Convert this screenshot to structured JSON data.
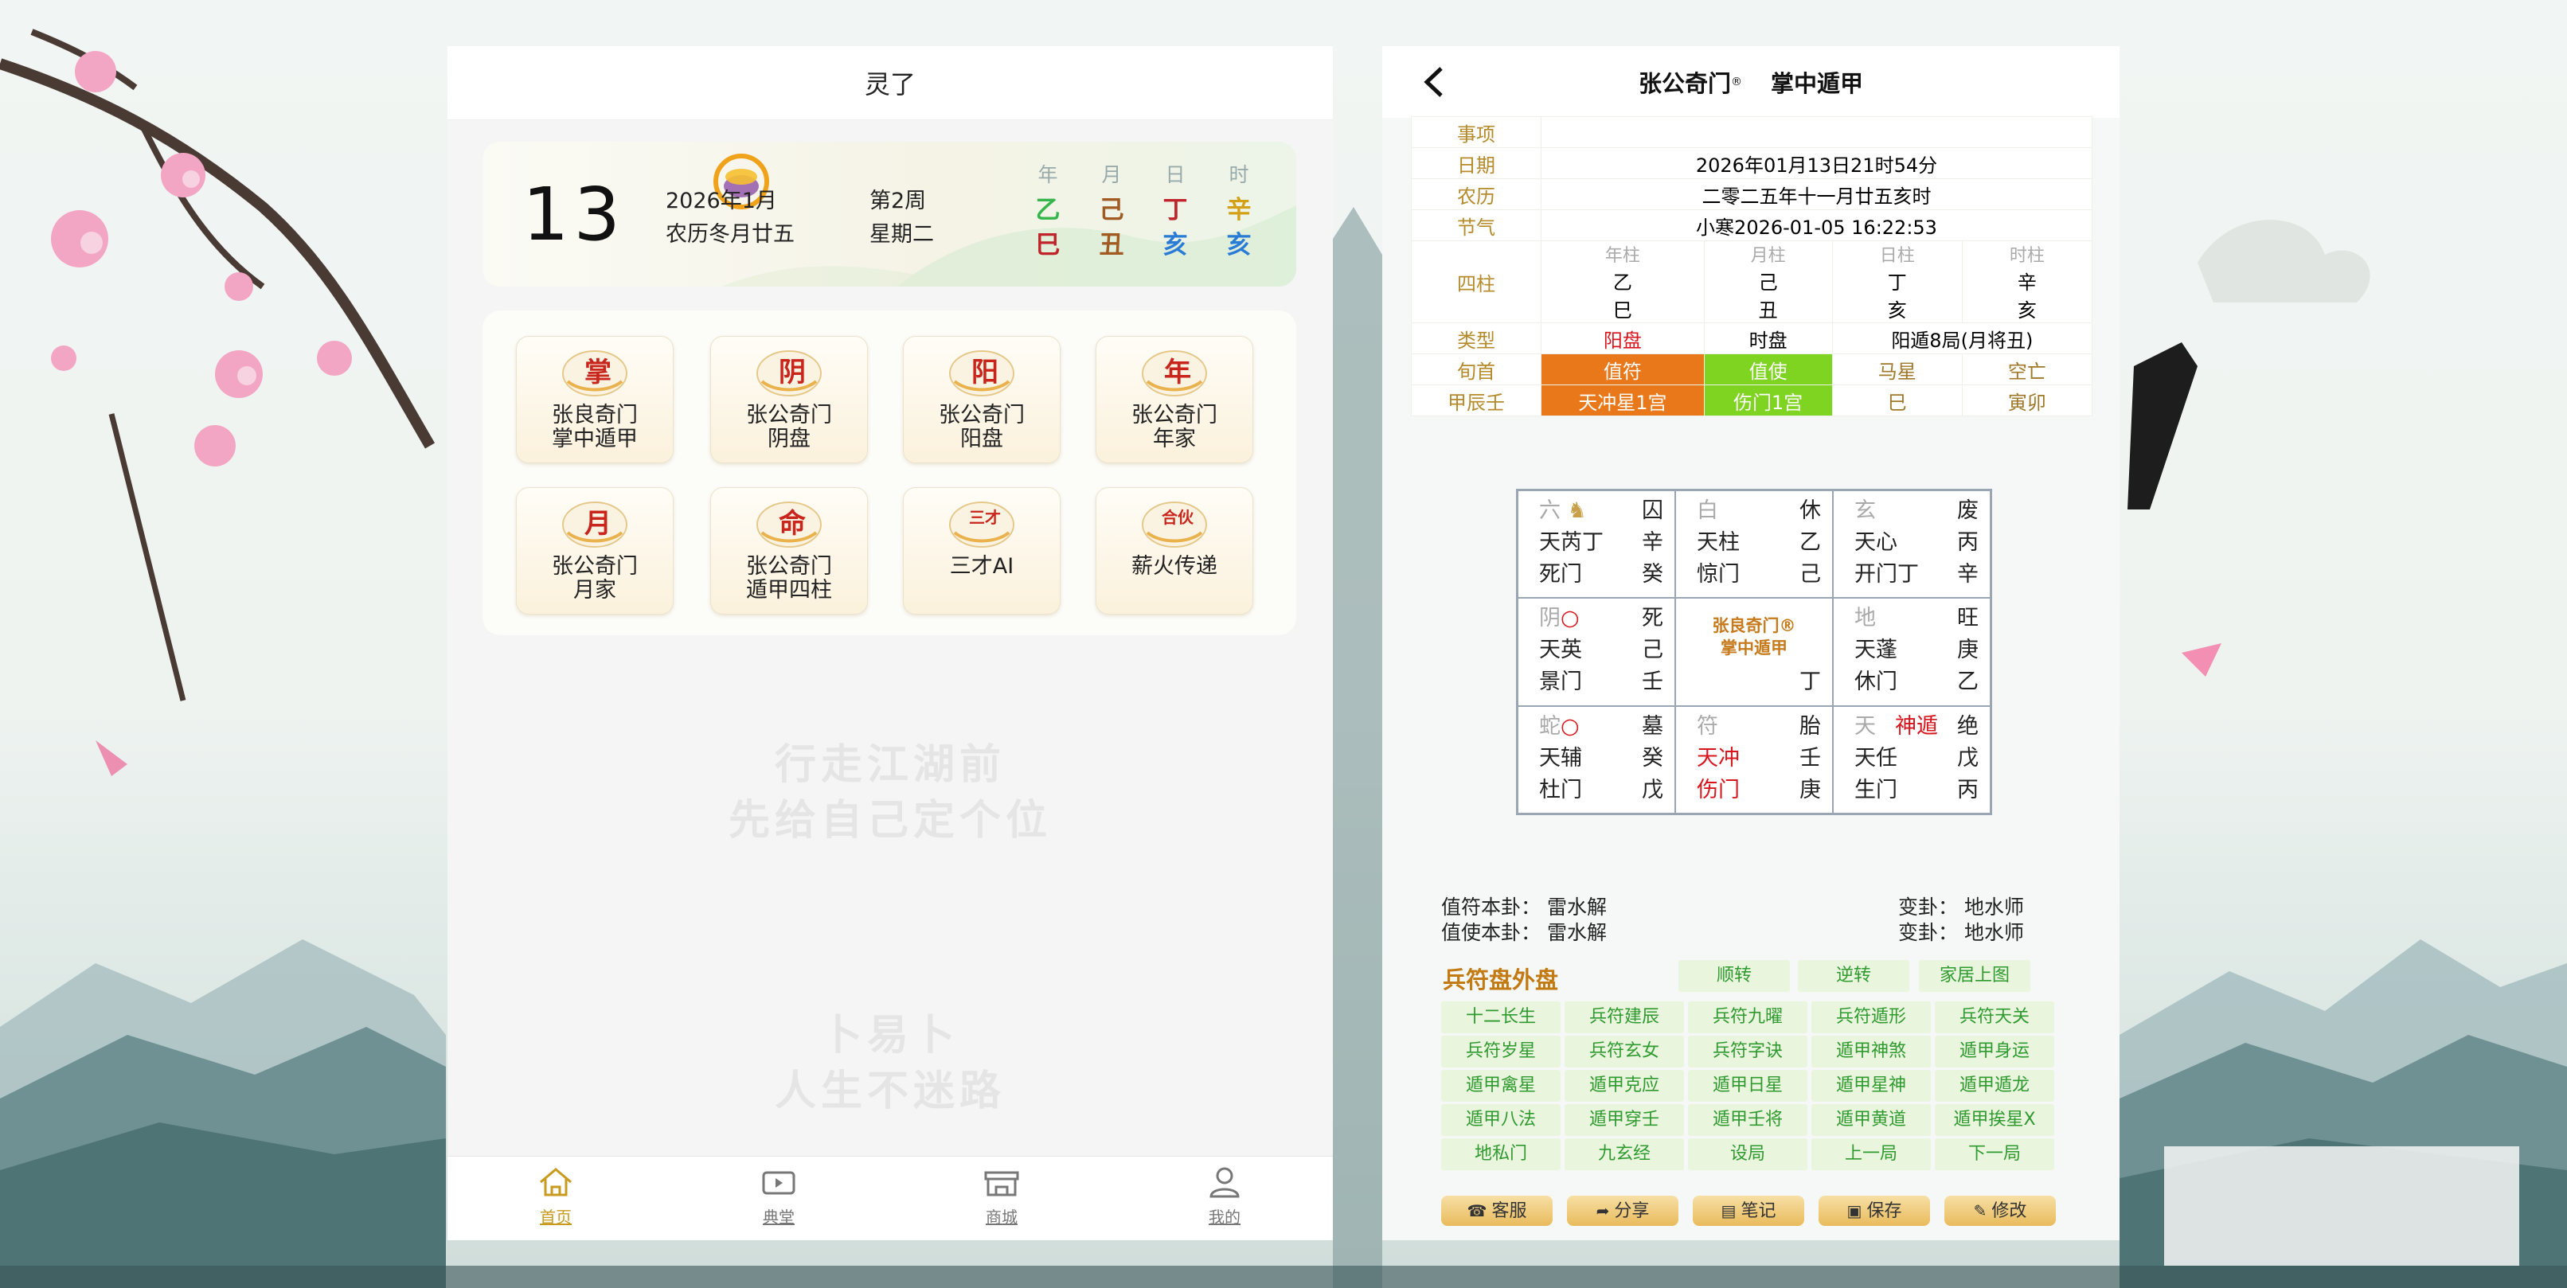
{
  "left_app": {
    "title": "灵了",
    "date": {
      "day": "13",
      "year_month": "2026年1月",
      "lunar": "农历冬月廿五",
      "week": "第2周",
      "weekday": "星期二"
    },
    "ganzhi": [
      {
        "head": "年",
        "stem": "乙",
        "branch": "巳",
        "stem_color": "#35b54a",
        "branch_color": "#c0242b"
      },
      {
        "head": "月",
        "stem": "己",
        "branch": "丑",
        "stem_color": "#a05a22",
        "branch_color": "#a05a22"
      },
      {
        "head": "日",
        "stem": "丁",
        "branch": "亥",
        "stem_color": "#c0242b",
        "branch_color": "#2a7bd4"
      },
      {
        "head": "时",
        "stem": "辛",
        "branch": "亥",
        "stem_color": "#d4a017",
        "branch_color": "#2a7bd4"
      }
    ],
    "menu": [
      {
        "emblem": "掌",
        "line1": "张良奇门",
        "line2": "掌中遁甲"
      },
      {
        "emblem": "阴",
        "line1": "张公奇门",
        "line2": "阴盘"
      },
      {
        "emblem": "阳",
        "line1": "张公奇门",
        "line2": "阳盘"
      },
      {
        "emblem": "年",
        "line1": "张公奇门",
        "line2": "年家"
      },
      {
        "emblem": "月",
        "line1": "张公奇门",
        "line2": "月家"
      },
      {
        "emblem": "命",
        "line1": "张公奇门",
        "line2": "遁甲四柱"
      },
      {
        "emblem": "三才",
        "line1": "三才AI",
        "line2": ""
      },
      {
        "emblem": "合伙",
        "line1": "薪火传递",
        "line2": ""
      }
    ],
    "watermark": [
      "行走江湖前",
      "先给自己定个位",
      "卜易卜",
      "人生不迷路"
    ],
    "nav": [
      {
        "label": "首页",
        "icon": "home-icon",
        "active": true
      },
      {
        "label": "典堂",
        "icon": "tv-icon",
        "active": false
      },
      {
        "label": "商城",
        "icon": "shop-icon",
        "active": false
      },
      {
        "label": "我的",
        "icon": "user-icon",
        "active": false
      }
    ]
  },
  "right_app": {
    "header": {
      "title": "张公奇门",
      "reg": "®",
      "subtitle": "掌中遁甲"
    },
    "info": {
      "items_label": "事项",
      "date_label": "日期",
      "date_value": "2026年01月13日21时54分",
      "lunar_label": "农历",
      "lunar_value": "二零二五年十一月廿五亥时",
      "term_label": "节气",
      "term_value": "小寒2026-01-05 16:22:53",
      "pillars_label": "四柱",
      "pillars": [
        {
          "head": "年柱",
          "stem": "乙",
          "branch": "巳"
        },
        {
          "head": "月柱",
          "stem": "己",
          "branch": "丑"
        },
        {
          "head": "日柱",
          "stem": "丁",
          "branch": "亥"
        },
        {
          "head": "时柱",
          "stem": "辛",
          "branch": "亥"
        }
      ],
      "type_label": "类型",
      "type_pan": "阳盘",
      "time_pan": "时盘",
      "ju": "阳遁8局(月将丑)",
      "xun_label": "旬首",
      "zhifu": "值符",
      "zhishi": "值使",
      "maxing": "马星",
      "kongwang": "空亡",
      "jiachen_label": "甲辰壬",
      "tianchong": "天冲星1宫",
      "shangmen": "伤门1宫",
      "ma_value": "巳",
      "kong_value": "寅卯"
    },
    "grid": [
      {
        "l1": [
          "六",
          "囚"
        ],
        "l2": [
          "天芮丁",
          "辛"
        ],
        "l3": [
          "死门",
          "癸"
        ]
      },
      {
        "l1": [
          "白",
          "休"
        ],
        "l2": [
          "天柱",
          "乙"
        ],
        "l3": [
          "惊门",
          "己"
        ]
      },
      {
        "l1": [
          "玄",
          "废"
        ],
        "l2": [
          "天心",
          "丙"
        ],
        "l3": [
          "开门丁",
          "辛"
        ]
      },
      {
        "l1": [
          "阴",
          "死"
        ],
        "l2": [
          "天英",
          "己"
        ],
        "l3": [
          "景门",
          "壬"
        ]
      },
      {
        "center": [
          "张良奇门®",
          "掌中遁甲"
        ],
        "c3": "丁"
      },
      {
        "l1": [
          "地",
          "旺"
        ],
        "l2": [
          "天蓬",
          "庚"
        ],
        "l3": [
          "休门",
          "乙"
        ]
      },
      {
        "l1": [
          "蛇",
          "墓"
        ],
        "l2": [
          "天辅",
          "癸"
        ],
        "l3": [
          "杜门",
          "戊"
        ]
      },
      {
        "l1": [
          "符",
          "胎"
        ],
        "l2": [
          "天冲",
          "壬"
        ],
        "l3": [
          "伤门",
          "庚"
        ]
      },
      {
        "l1": [
          "天",
          "神遁",
          "绝"
        ],
        "l2": [
          "天任",
          "戊"
        ],
        "l3": [
          "生门",
          "丙"
        ]
      }
    ],
    "gua": {
      "zhifu_label": "值符本卦：",
      "zhifu_value": "雷水解",
      "zhishi_label": "值使本卦：",
      "zhishi_value": "雷水解",
      "bian1_label": "变卦：",
      "bian1_value": "地水师",
      "bian2_label": "变卦：",
      "bian2_value": "地水师"
    },
    "outer_title": "兵符盘外盘",
    "top_buttons": [
      "顺转",
      "逆转",
      "家居上图"
    ],
    "ext_buttons": [
      "十二长生",
      "兵符建辰",
      "兵符九曜",
      "兵符遁形",
      "兵符天关",
      "兵符岁星",
      "兵符玄女",
      "兵符字诀",
      "遁甲神煞",
      "遁甲身运",
      "遁甲禽星",
      "遁甲克应",
      "遁甲日星",
      "遁甲星神",
      "遁甲遁龙",
      "遁甲八法",
      "遁甲穿壬",
      "遁甲壬将",
      "遁甲黄道",
      "遁甲挨星X",
      "地私门",
      "九玄经",
      "设局",
      "上一局",
      "下一局"
    ],
    "actions": [
      {
        "label": "客服",
        "icon": "service-icon"
      },
      {
        "label": "分享",
        "icon": "share-icon"
      },
      {
        "label": "笔记",
        "icon": "note-icon"
      },
      {
        "label": "保存",
        "icon": "save-icon"
      },
      {
        "label": "修改",
        "icon": "edit-icon"
      }
    ]
  }
}
